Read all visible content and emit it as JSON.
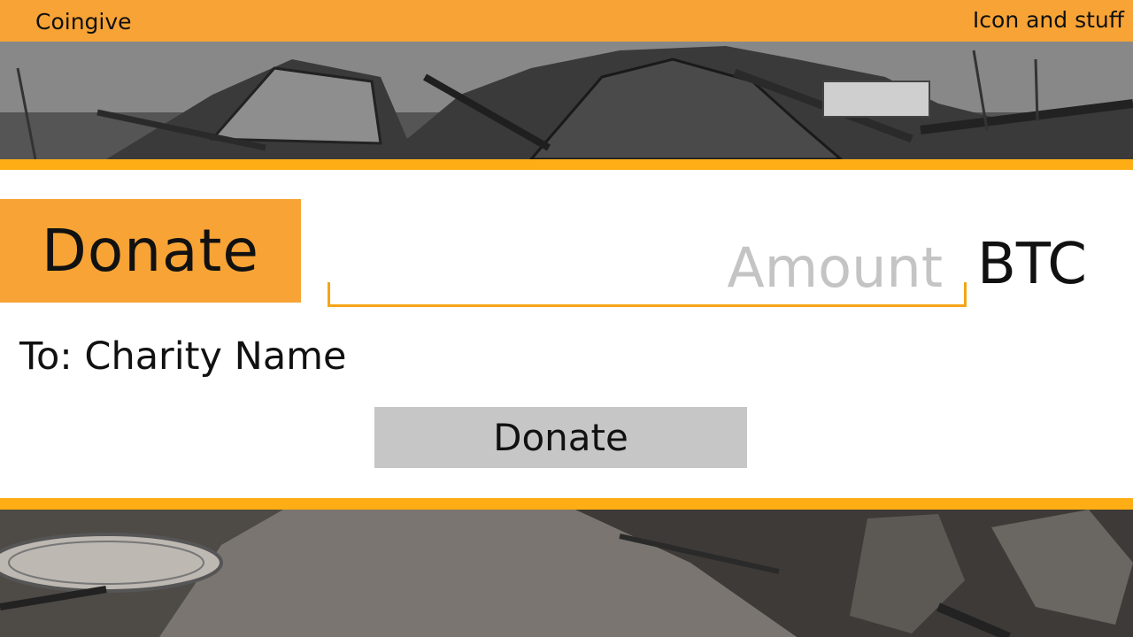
{
  "header": {
    "brand": "Coingive",
    "right_text": "Icon and stuff"
  },
  "donate": {
    "title": "Donate",
    "amount_placeholder": "Amount",
    "currency": "BTC",
    "recipient": "To: Charity Name",
    "button_label": "Donate"
  },
  "colors": {
    "header_orange": "#f7a335",
    "accent_stripe": "#ffad14",
    "button_grey": "#c6c6c6"
  }
}
